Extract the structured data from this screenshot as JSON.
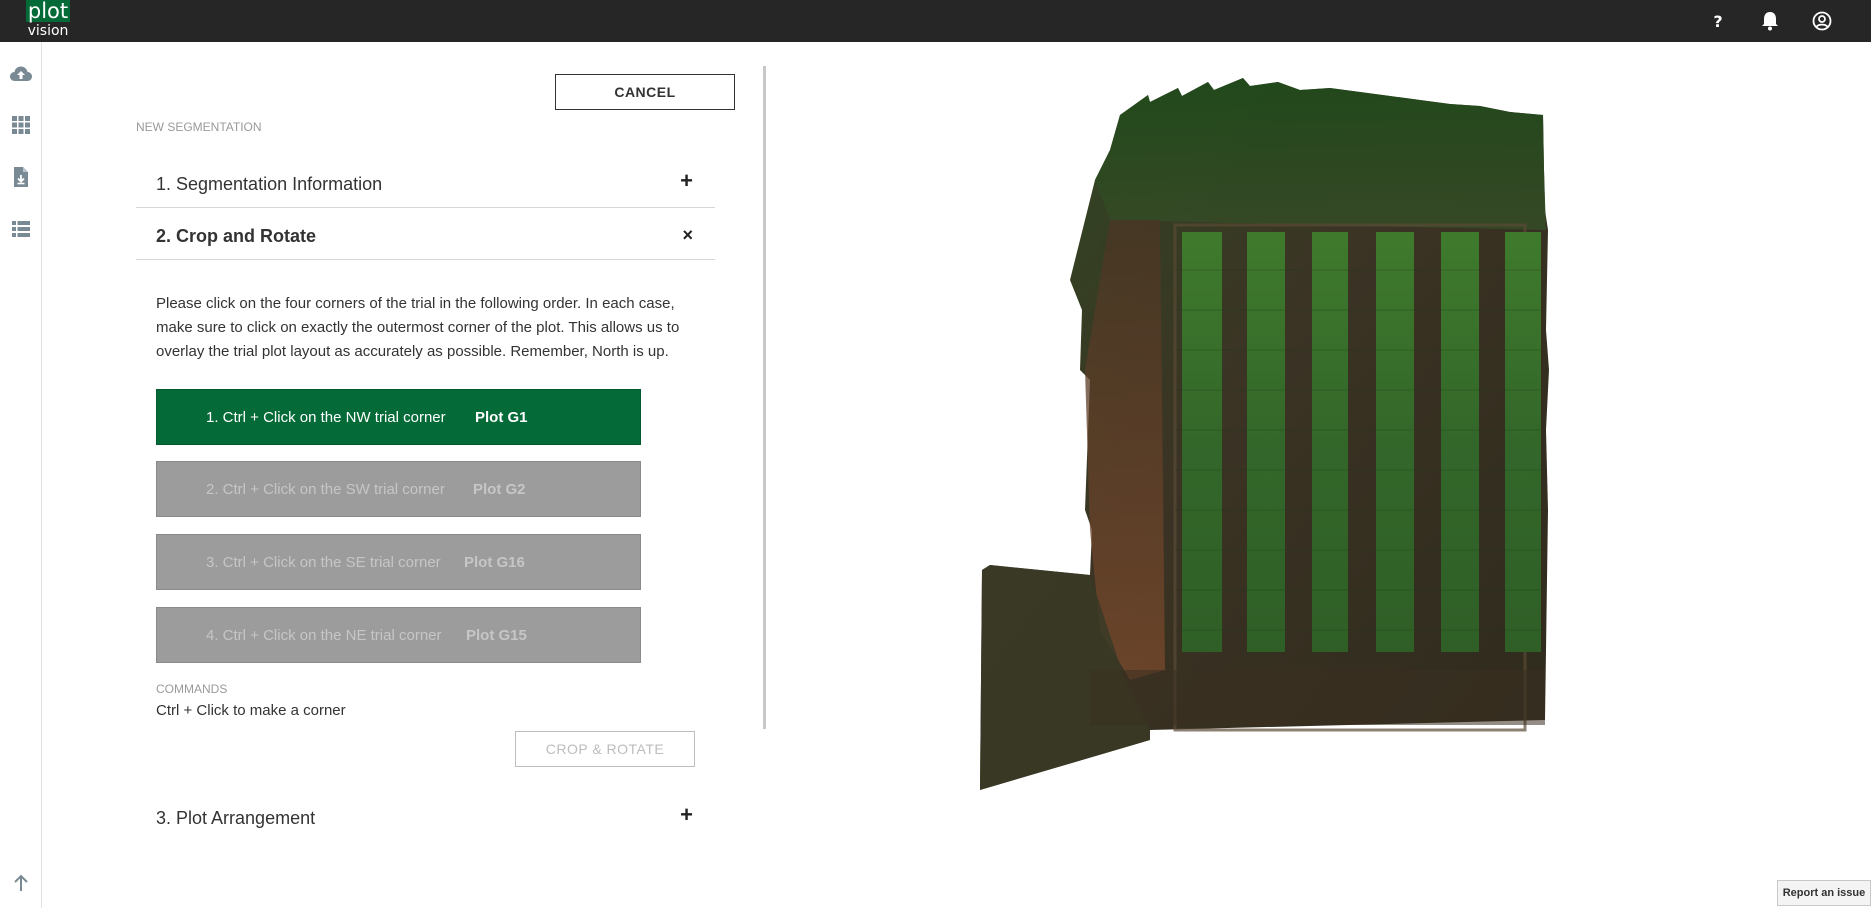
{
  "app": {
    "logo_top": "plot",
    "logo_bottom": "vision"
  },
  "topbar": {
    "help_icon": "question-mark-icon",
    "notifications_icon": "bell-icon",
    "account_icon": "user-circle-icon"
  },
  "sidebar": {
    "items": [
      {
        "icon": "cloud-upload-icon"
      },
      {
        "icon": "grid-icon"
      },
      {
        "icon": "file-download-icon"
      },
      {
        "icon": "list-icon"
      }
    ],
    "scroll_top_icon": "arrow-up-icon"
  },
  "panel": {
    "cancel_label": "CANCEL",
    "subtitle": "NEW SEGMENTATION",
    "sections": [
      {
        "title": "1. Segmentation Information",
        "toggle": "+"
      },
      {
        "title": "2. Crop and Rotate",
        "toggle": "×"
      },
      {
        "title": "3. Plot Arrangement",
        "toggle": "+"
      }
    ],
    "instructions": "Please click on the four corners of the trial in the following order. In each case, make sure to click on exactly the outermost corner of the plot. This allows us to overlay the trial plot layout as accurately as possible. Remember, North is up.",
    "corners": [
      {
        "step": "1. Ctrl + Click on the NW trial corner",
        "plot": "Plot G1",
        "active": true
      },
      {
        "step": "2. Ctrl + Click on the SW trial corner",
        "plot": "Plot G2",
        "active": false
      },
      {
        "step": "3. Ctrl + Click on the SE trial corner",
        "plot": "Plot G16",
        "active": false
      },
      {
        "step": "4. Ctrl + Click on the NE trial corner",
        "plot": "Plot G15",
        "active": false
      }
    ],
    "commands_label": "COMMANDS",
    "commands_text": "Ctrl + Click to make a corner",
    "crop_label": "CROP & ROTATE"
  },
  "report_label": "Report an issue",
  "colors": {
    "accent": "#046b38",
    "topbar": "#262626",
    "inactive": "#9c9c9c"
  }
}
